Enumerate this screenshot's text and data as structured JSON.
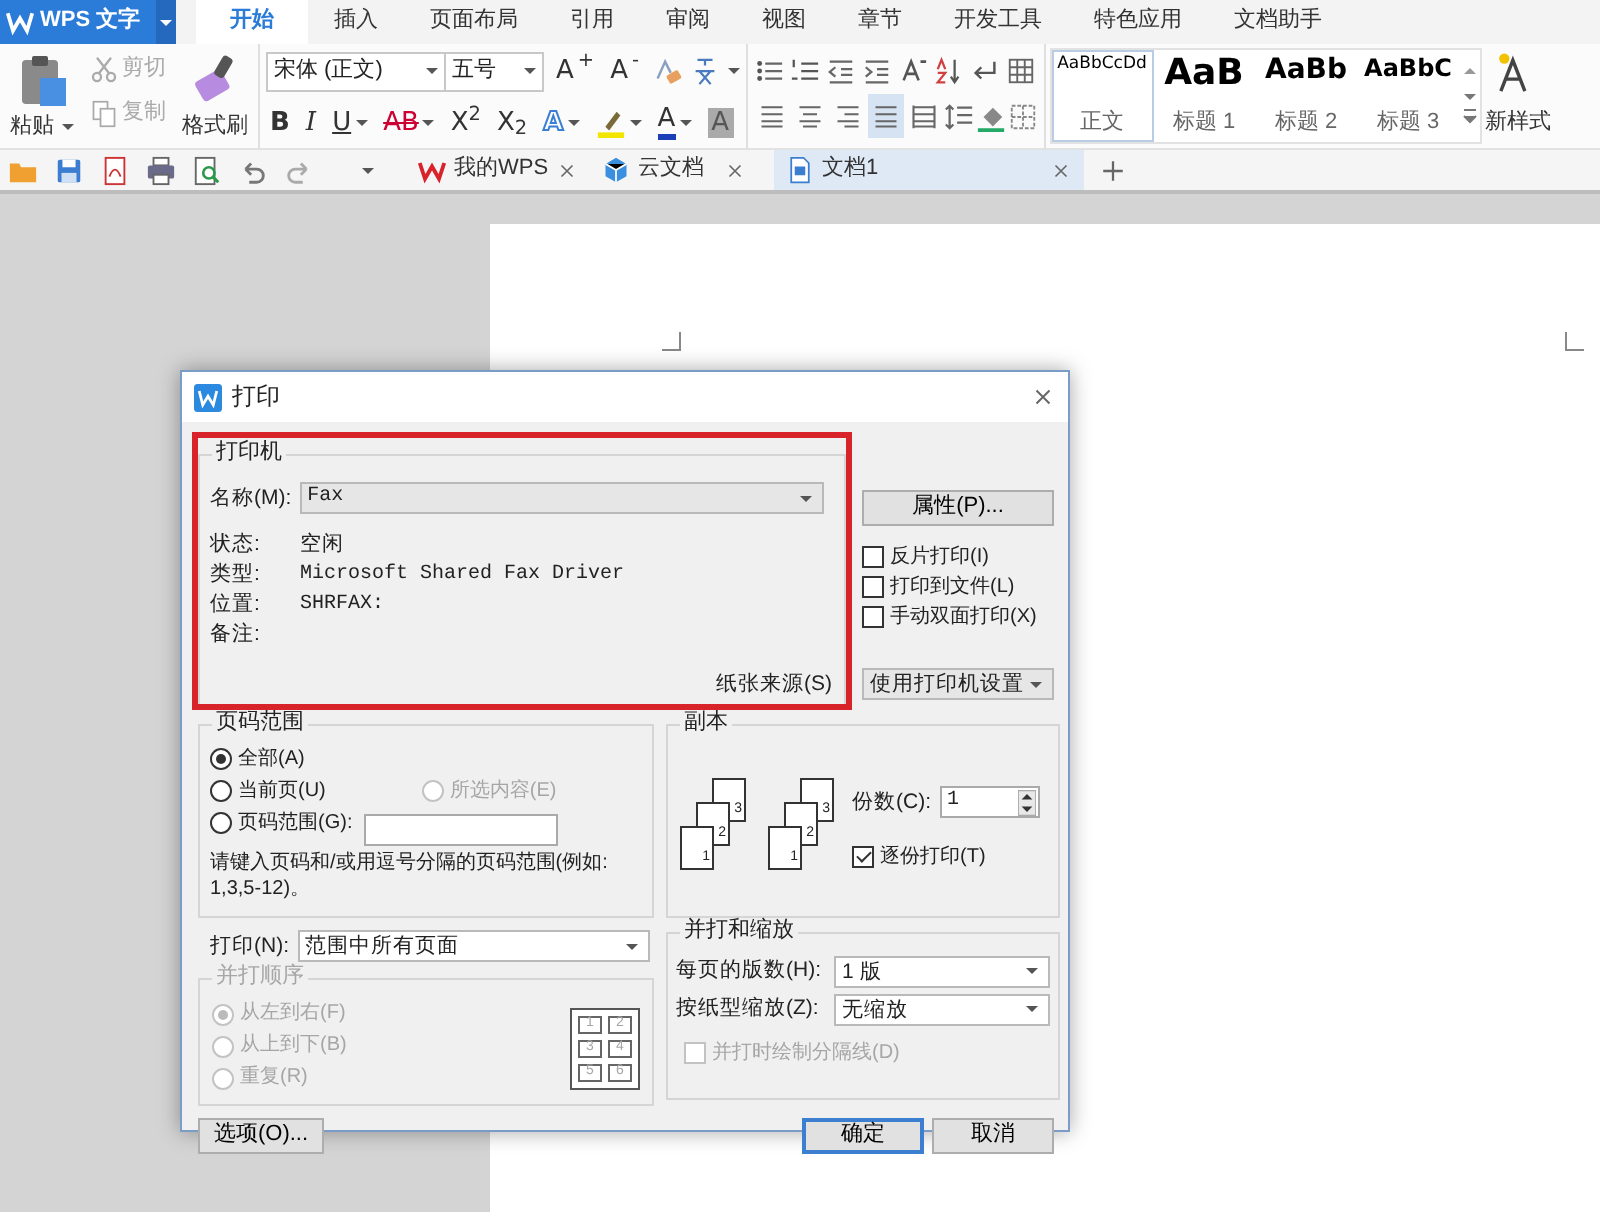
{
  "app_button": {
    "label": "WPS 文字"
  },
  "menu_tabs": [
    {
      "label": "开始",
      "selected": true
    },
    {
      "label": "插入",
      "selected": false
    },
    {
      "label": "页面布局",
      "selected": false
    },
    {
      "label": "引用",
      "selected": false
    },
    {
      "label": "审阅",
      "selected": false
    },
    {
      "label": "视图",
      "selected": false
    },
    {
      "label": "章节",
      "selected": false
    },
    {
      "label": "开发工具",
      "selected": false
    },
    {
      "label": "特色应用",
      "selected": false
    },
    {
      "label": "文档助手",
      "selected": false
    }
  ],
  "ribbon": {
    "paste": "粘贴",
    "cut": {
      "label": "剪切",
      "disabled": true
    },
    "copy": {
      "label": "复制",
      "disabled": true
    },
    "format_painter": "格式刷",
    "font_family": "宋体 (正文)",
    "font_size": "五号",
    "grow_font": "A$^{+}$",
    "shrink_font": "A$^{-}$",
    "format_buttons": [
      {
        "kind": "bold",
        "label": "B"
      },
      {
        "kind": "italic",
        "label": "I"
      },
      {
        "kind": "underline",
        "label": "U",
        "dropdown": true
      },
      {
        "kind": "strike",
        "label": "AB",
        "dropdown": true
      },
      {
        "kind": "superscript",
        "label": "X$^{2}$"
      },
      {
        "kind": "subscript",
        "label": "X$_{2}$"
      },
      {
        "kind": "effect",
        "label": "A",
        "dropdown": true
      },
      {
        "kind": "highlight",
        "dropdown": true
      },
      {
        "kind": "color",
        "label": "A",
        "dropdown": true
      },
      {
        "kind": "shade",
        "label": "A"
      }
    ],
    "alignments": [
      {
        "selected": false
      },
      {
        "selected": false
      },
      {
        "selected": false
      },
      {
        "selected": true
      },
      {
        "selected": false
      }
    ],
    "styles": [
      {
        "kind": "body",
        "sample": "AaBbCcDd",
        "name": "正文",
        "selected": true
      },
      {
        "kind": "h1",
        "sample": "AaB",
        "name": "标题 1",
        "selected": false
      },
      {
        "kind": "h2",
        "sample": "AaBb",
        "name": "标题 2",
        "selected": false
      },
      {
        "kind": "h3",
        "sample": "AaBbC",
        "name": "标题 3",
        "selected": false
      }
    ],
    "new_style": "新样式"
  },
  "doc_tabs": [
    {
      "kind": "wps",
      "label": "我的WPS",
      "selected": false
    },
    {
      "kind": "cloud",
      "label": "云文档",
      "selected": false
    },
    {
      "kind": "doc",
      "label": "文档1",
      "selected": true
    }
  ],
  "dialog": {
    "title": "打印",
    "printer": {
      "legend": "打印机",
      "highlighted": true,
      "name_label": "名称(M):",
      "name_value": "Fax",
      "info": [
        {
          "label": "状态:",
          "value": "空闲",
          "kind": "text"
        },
        {
          "label": "类型:",
          "value": "Microsoft Shared Fax Driver",
          "kind": "mono"
        },
        {
          "label": "位置:",
          "value": "SHRFAX:",
          "kind": "mono"
        },
        {
          "label": "备注:"
        }
      ],
      "paper_source": "纸张来源(S)"
    },
    "properties_button": "属性(P)...",
    "print_options": [
      {
        "label": "反片打印(I)",
        "checked": false
      },
      {
        "label": "打印到文件(L)",
        "checked": false
      },
      {
        "label": "手动双面打印(X)",
        "checked": false
      }
    ],
    "printer_settings": "使用打印机设置",
    "page_range": {
      "legend": "页码范围",
      "options": [
        {
          "label": "全部(A)",
          "selected": true,
          "disabled": false
        },
        {
          "label": "当前页(U)",
          "selected": false,
          "disabled": false
        },
        {
          "label": "所选内容(E)",
          "selected": false,
          "disabled": true
        },
        {
          "label": "页码范围(G):",
          "selected": false,
          "disabled": false
        }
      ],
      "hint": "请键入页码和/或用逗号分隔的页码范围(例如:\n1,3,5-12)。"
    },
    "copies": {
      "legend": "副本",
      "stacks": [
        [
          "1",
          "2",
          "3"
        ],
        [
          "1",
          "2",
          "3"
        ]
      ],
      "count_label": "份数(C):",
      "count_value": "1",
      "collate": {
        "label": "逐份打印(T)",
        "checked": true
      }
    },
    "print_what": {
      "label": "打印(N):",
      "value": "范围中所有页面"
    },
    "order": {
      "legend": "并打顺序",
      "disabled": true,
      "options": [
        {
          "label": "从左到右(F)",
          "selected": true
        },
        {
          "label": "从上到下(B)",
          "selected": false
        },
        {
          "label": "重复(R)",
          "selected": false
        }
      ],
      "preview": [
        "1",
        "2",
        "3",
        "4",
        "5",
        "6"
      ]
    },
    "scaling": {
      "legend": "并打和缩放",
      "rows": [
        {
          "label": "每页的版数(H):",
          "value": "1 版"
        },
        {
          "label": "按纸型缩放(Z):",
          "value": "无缩放"
        }
      ],
      "divider": {
        "label": "并打时绘制分隔线(D)",
        "checked": false,
        "disabled": true
      }
    },
    "buttons": [
      {
        "kind": "options",
        "label": "选项(O)..."
      },
      {
        "kind": "ok",
        "label": "确定",
        "default": true
      },
      {
        "kind": "cancel",
        "label": "取消",
        "default": false
      }
    ]
  }
}
